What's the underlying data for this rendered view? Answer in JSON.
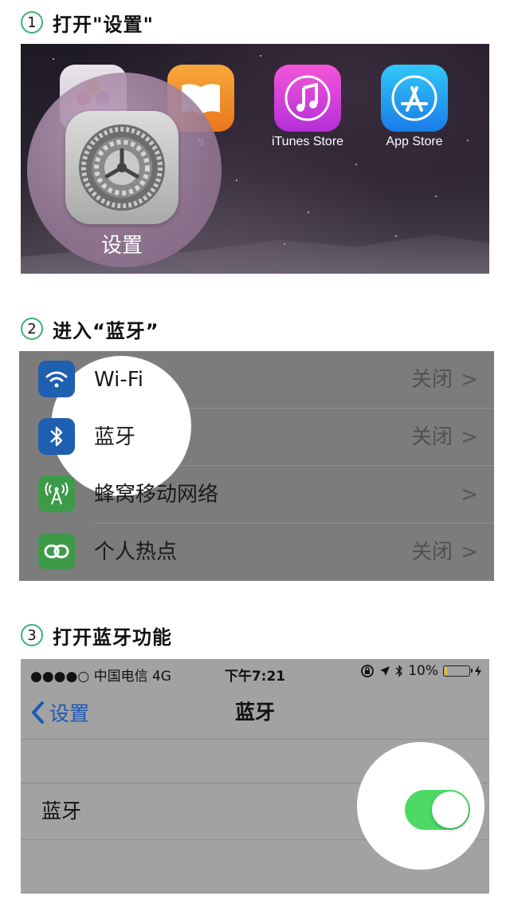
{
  "steps": [
    {
      "num": "1",
      "title": "打开\"设置\""
    },
    {
      "num": "2",
      "title": "进入“蓝牙”"
    },
    {
      "num": "3",
      "title": "打开蓝牙功能"
    }
  ],
  "home_screen": {
    "apps": [
      {
        "label": "",
        "icon": "photos-icon"
      },
      {
        "label": "s",
        "icon": "ibooks-icon"
      },
      {
        "label": "iTunes Store",
        "icon": "itunes-store-icon"
      },
      {
        "label": "App Store",
        "icon": "app-store-icon"
      }
    ],
    "highlighted_app": {
      "label": "设置",
      "icon": "settings-gear-icon"
    }
  },
  "settings_list": {
    "rows": [
      {
        "label": "Wi-Fi",
        "value": "关闭",
        "chevron": ">",
        "icon": "wifi-icon",
        "icon_color": "#1f5fb0"
      },
      {
        "label": "蓝牙",
        "value": "关闭",
        "chevron": ">",
        "icon": "bluetooth-icon",
        "icon_color": "#1f5fb0"
      },
      {
        "label": "蜂窝移动网络",
        "value": "",
        "chevron": ">",
        "icon": "cellular-icon",
        "icon_color": "#3d9a49"
      },
      {
        "label": "个人热点",
        "value": "关闭",
        "chevron": ">",
        "icon": "hotspot-icon",
        "icon_color": "#3d9a49"
      }
    ]
  },
  "bluetooth_page": {
    "status_bar": {
      "carrier": "●●●●○ 中国电信  4G",
      "time": "下午7:21",
      "battery": "10%",
      "battery_level": 0.1
    },
    "nav": {
      "back_label": "设置",
      "title": "蓝牙"
    },
    "toggle_row": {
      "label": "蓝牙",
      "enabled": true
    },
    "colors": {
      "accent": "#1b59b8",
      "toggle_on": "#4cd964",
      "step_circle": "#3cb371"
    }
  }
}
